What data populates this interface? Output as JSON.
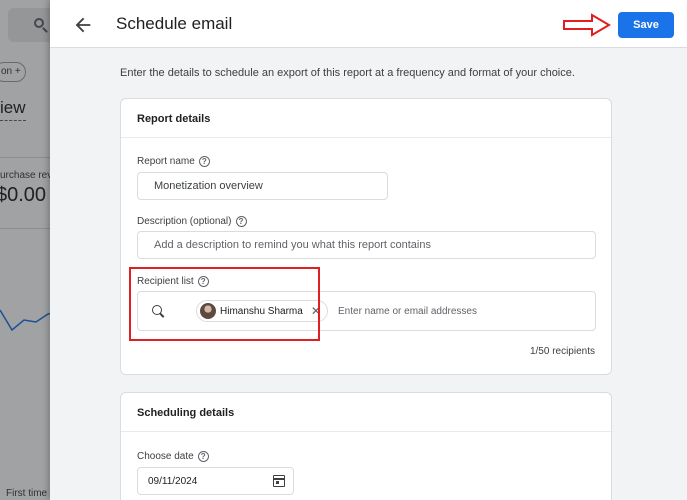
{
  "background": {
    "chip_label": "on",
    "chip_plus": "+",
    "title_fragment": "iew",
    "metric_label_fragment": "urchase rev",
    "metric_value_fragment": "$0.00",
    "footer_fragment": "First time"
  },
  "header": {
    "back_icon": "arrow-back-icon",
    "title": "Schedule email",
    "save_label": "Save"
  },
  "intro_text": "Enter the details to schedule an export of this report at a frequency and format of your choice.",
  "report_details": {
    "title": "Report details",
    "report_name_label": "Report name",
    "report_name_value": "Monetization overview",
    "description_label": "Description (optional)",
    "description_placeholder": "Add a description to remind you what this report contains",
    "recipient_label": "Recipient list",
    "recipient_chip_name": "Himanshu Sharma",
    "recipient_placeholder": "Enter name or email addresses",
    "recipient_count": "1/50 recipients"
  },
  "scheduling_details": {
    "title": "Scheduling details",
    "choose_date_label": "Choose date",
    "date_value": "09/11/2024"
  },
  "colors": {
    "accent": "#1a73e8",
    "annotation": "#e02020"
  }
}
